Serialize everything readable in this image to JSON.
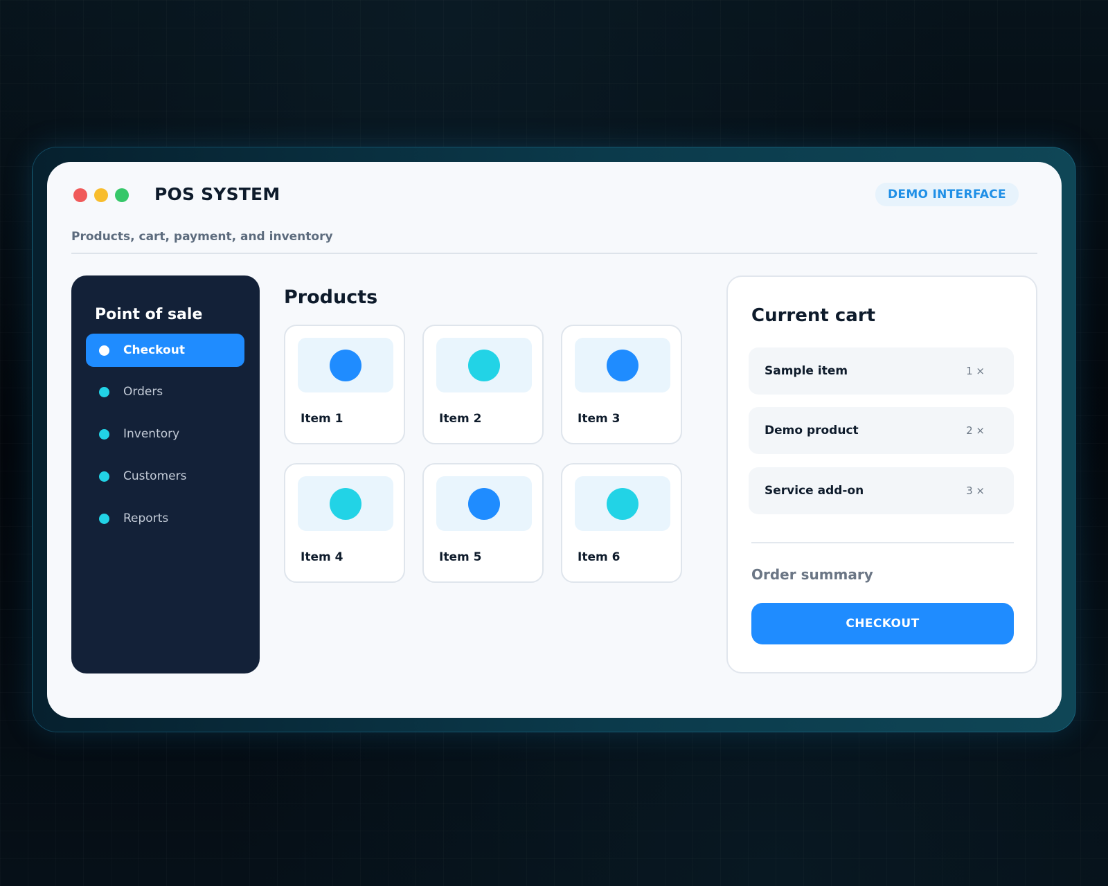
{
  "window": {
    "title": "POS SYSTEM",
    "badge": "DEMO INTERFACE",
    "subtitle": "Products, cart, payment, and inventory"
  },
  "sidebar": {
    "title": "Point of sale",
    "items": [
      {
        "label": "Checkout",
        "active": true
      },
      {
        "label": "Orders"
      },
      {
        "label": "Inventory"
      },
      {
        "label": "Customers"
      },
      {
        "label": "Reports"
      }
    ]
  },
  "products": {
    "title": "Products",
    "items": [
      {
        "name": "Item 1",
        "color": "#1f8cff"
      },
      {
        "name": "Item 2",
        "color": "#22d3e6"
      },
      {
        "name": "Item 3",
        "color": "#1f8cff"
      },
      {
        "name": "Item 4",
        "color": "#22d3e6"
      },
      {
        "name": "Item 5",
        "color": "#1f8cff"
      },
      {
        "name": "Item 6",
        "color": "#22d3e6"
      }
    ]
  },
  "cart": {
    "title": "Current cart",
    "items": [
      {
        "name": "Sample item",
        "qty": "1 ×"
      },
      {
        "name": "Demo product",
        "qty": "2 ×"
      },
      {
        "name": "Service add-on",
        "qty": "3 ×"
      }
    ],
    "summary_label": "Order summary",
    "checkout_label": "CHECKOUT"
  },
  "colors": {
    "accent": "#1f8cff",
    "cyan": "#22d3e6",
    "sidebar_bg": "#132138"
  }
}
